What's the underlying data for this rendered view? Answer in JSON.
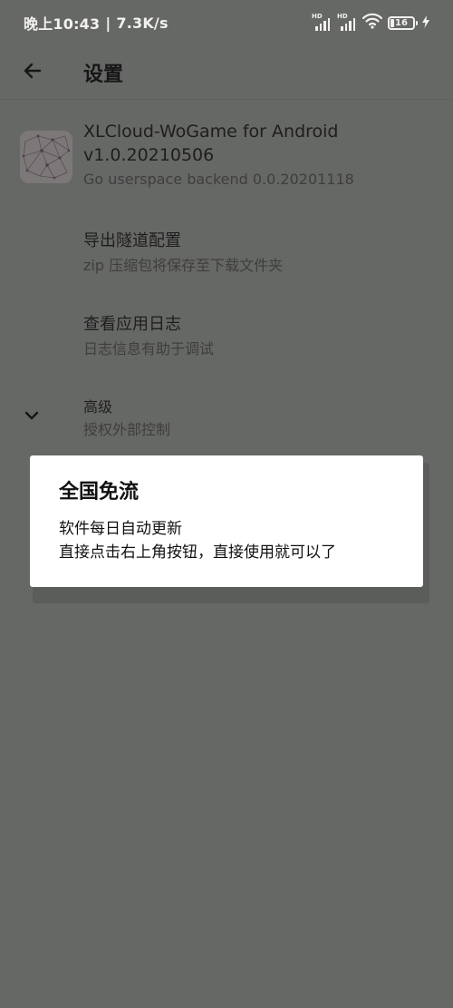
{
  "status_bar": {
    "time": "晚上10:43",
    "separator": "|",
    "speed": "7.3K/s",
    "battery_level": 16,
    "battery_label": "16",
    "icons": [
      "hd-signal-icon",
      "hd-signal-icon",
      "wifi-icon",
      "battery-icon",
      "charging-bolt-icon"
    ]
  },
  "app_bar": {
    "back_icon": "arrow-left-icon",
    "title": "设置"
  },
  "about": {
    "icon": "app-logo-icon",
    "name": "XLCloud-WoGame for Android",
    "version": "v1.0.20210506",
    "backend": "Go userspace backend 0.0.20201118"
  },
  "items": [
    {
      "title": "导出隧道配置",
      "subtitle": "zip 压缩包将保存至下载文件夹"
    },
    {
      "title": "查看应用日志",
      "subtitle": "日志信息有助于调试"
    },
    {
      "title": "高级",
      "subtitle": "授权外部控制",
      "icon": "chevron-down-icon"
    }
  ],
  "dialog": {
    "title": "全国免流",
    "line1": "软件每日自动更新",
    "line2": "直接点击右上角按钮，直接使用就可以了"
  },
  "colors": {
    "background": "#666865",
    "dialog": "#ffffff",
    "text_dark": "#1e1e1e",
    "status_text": "#f1f1ef"
  }
}
